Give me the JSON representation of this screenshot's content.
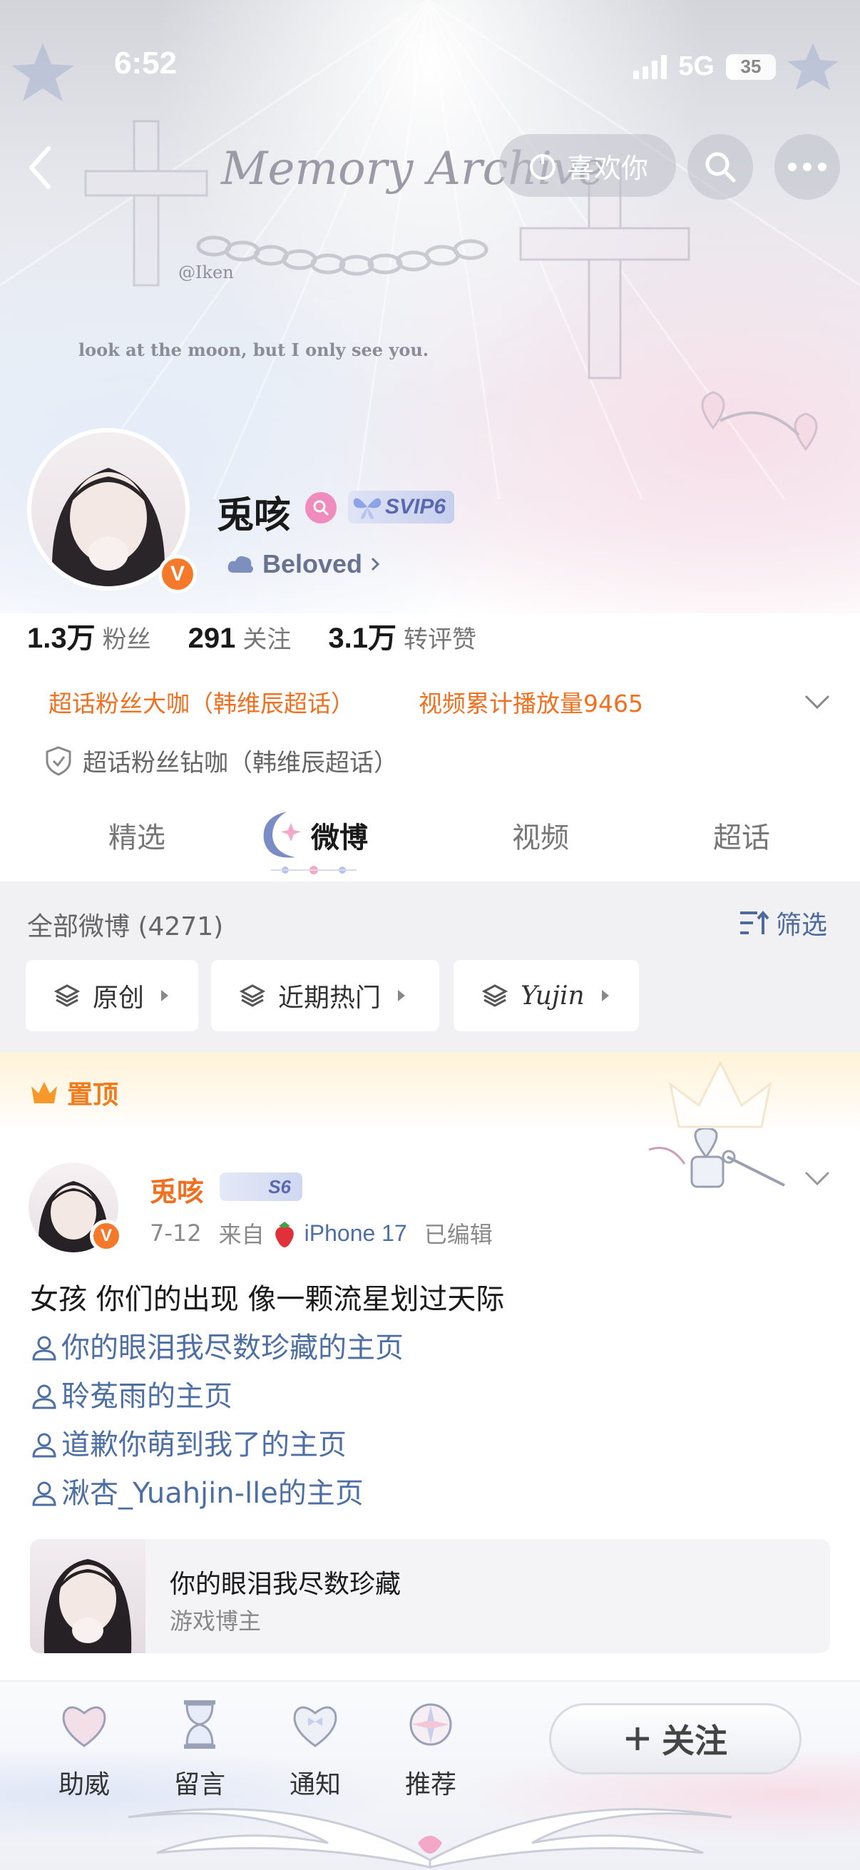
{
  "status_bar": {
    "time": "6:52",
    "network": "5G",
    "battery": "35"
  },
  "header": {
    "banner_title": "Memory Archive",
    "banner_handle": "@Iken",
    "banner_quote": "look at the moon, but I only see you.",
    "like_label": "喜欢你"
  },
  "profile": {
    "name": "兎咳",
    "vip_badge": "SVIP6",
    "tagline": "Beloved",
    "verified": "V",
    "stats": [
      {
        "value": "1.3万",
        "label": "粉丝"
      },
      {
        "value": "291",
        "label": "关注"
      },
      {
        "value": "3.1万",
        "label": "转评赞"
      }
    ],
    "achievements": {
      "left": "超话粉丝大咖（韩维辰超话）",
      "right": "视频累计播放量9465",
      "second": "超话粉丝钻咖（韩维辰超话）"
    }
  },
  "tabs": [
    {
      "label": "精选"
    },
    {
      "label": "微博"
    },
    {
      "label": "视频"
    },
    {
      "label": "超话"
    }
  ],
  "feed": {
    "count_label": "全部微博 (4271)",
    "filter_label": "筛选",
    "chips": [
      {
        "label": "原创"
      },
      {
        "label": "近期热门"
      },
      {
        "label": "Yujin"
      }
    ],
    "pinned_label": "置顶"
  },
  "post": {
    "author": "兎咳",
    "level": "S6",
    "date": "7-12",
    "source_prefix": "来自",
    "device": "iPhone 17",
    "edited": "已编辑",
    "text": "女孩 你们的出现 像一颗流星划过天际",
    "mentions": [
      "你的眼泪我尽数珍藏的主页",
      "聆菟雨的主页",
      "道歉你萌到我了的主页",
      "湫杏_Yuahjin-lle的主页"
    ],
    "card": {
      "title": "你的眼泪我尽数珍藏",
      "subtitle": "游戏博主"
    }
  },
  "bottom_bar": {
    "items": [
      {
        "label": "助威"
      },
      {
        "label": "留言"
      },
      {
        "label": "通知"
      },
      {
        "label": "推荐"
      }
    ],
    "follow_label": "关注"
  },
  "colors": {
    "accent_orange": "#f07020",
    "link_blue": "#4e6fa3",
    "section_gray": "#f1f1f3"
  }
}
